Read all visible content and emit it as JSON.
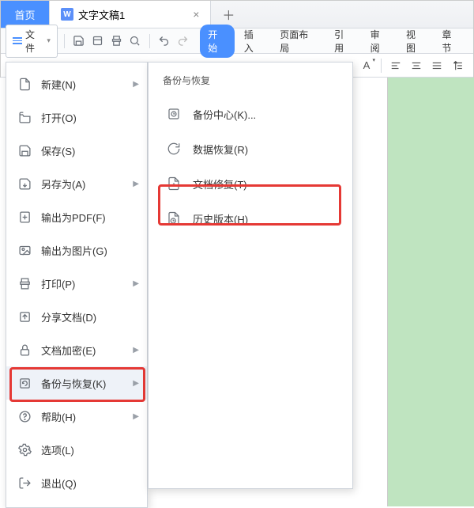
{
  "tabs": {
    "home": "首页",
    "doc": "文字文稿1",
    "doc_icon_letter": "W"
  },
  "file_button": "文件",
  "ribbon": {
    "start": "开始",
    "insert": "插入",
    "layout": "页面布局",
    "reference": "引用",
    "review": "审阅",
    "view": "视图",
    "chapter": "章节"
  },
  "filemenu": {
    "new": "新建(N)",
    "open": "打开(O)",
    "save": "保存(S)",
    "saveas": "另存为(A)",
    "exportpdf": "输出为PDF(F)",
    "exportimg": "输出为图片(G)",
    "print": "打印(P)",
    "share": "分享文档(D)",
    "encrypt": "文档加密(E)",
    "backup": "备份与恢复(K)",
    "help": "帮助(H)",
    "options": "选项(L)",
    "exit": "退出(Q)"
  },
  "submenu": {
    "header": "备份与恢复",
    "center": "备份中心(K)...",
    "recover": "数据恢复(R)",
    "repair": "文档修复(T)",
    "history": "历史版本(H)"
  }
}
